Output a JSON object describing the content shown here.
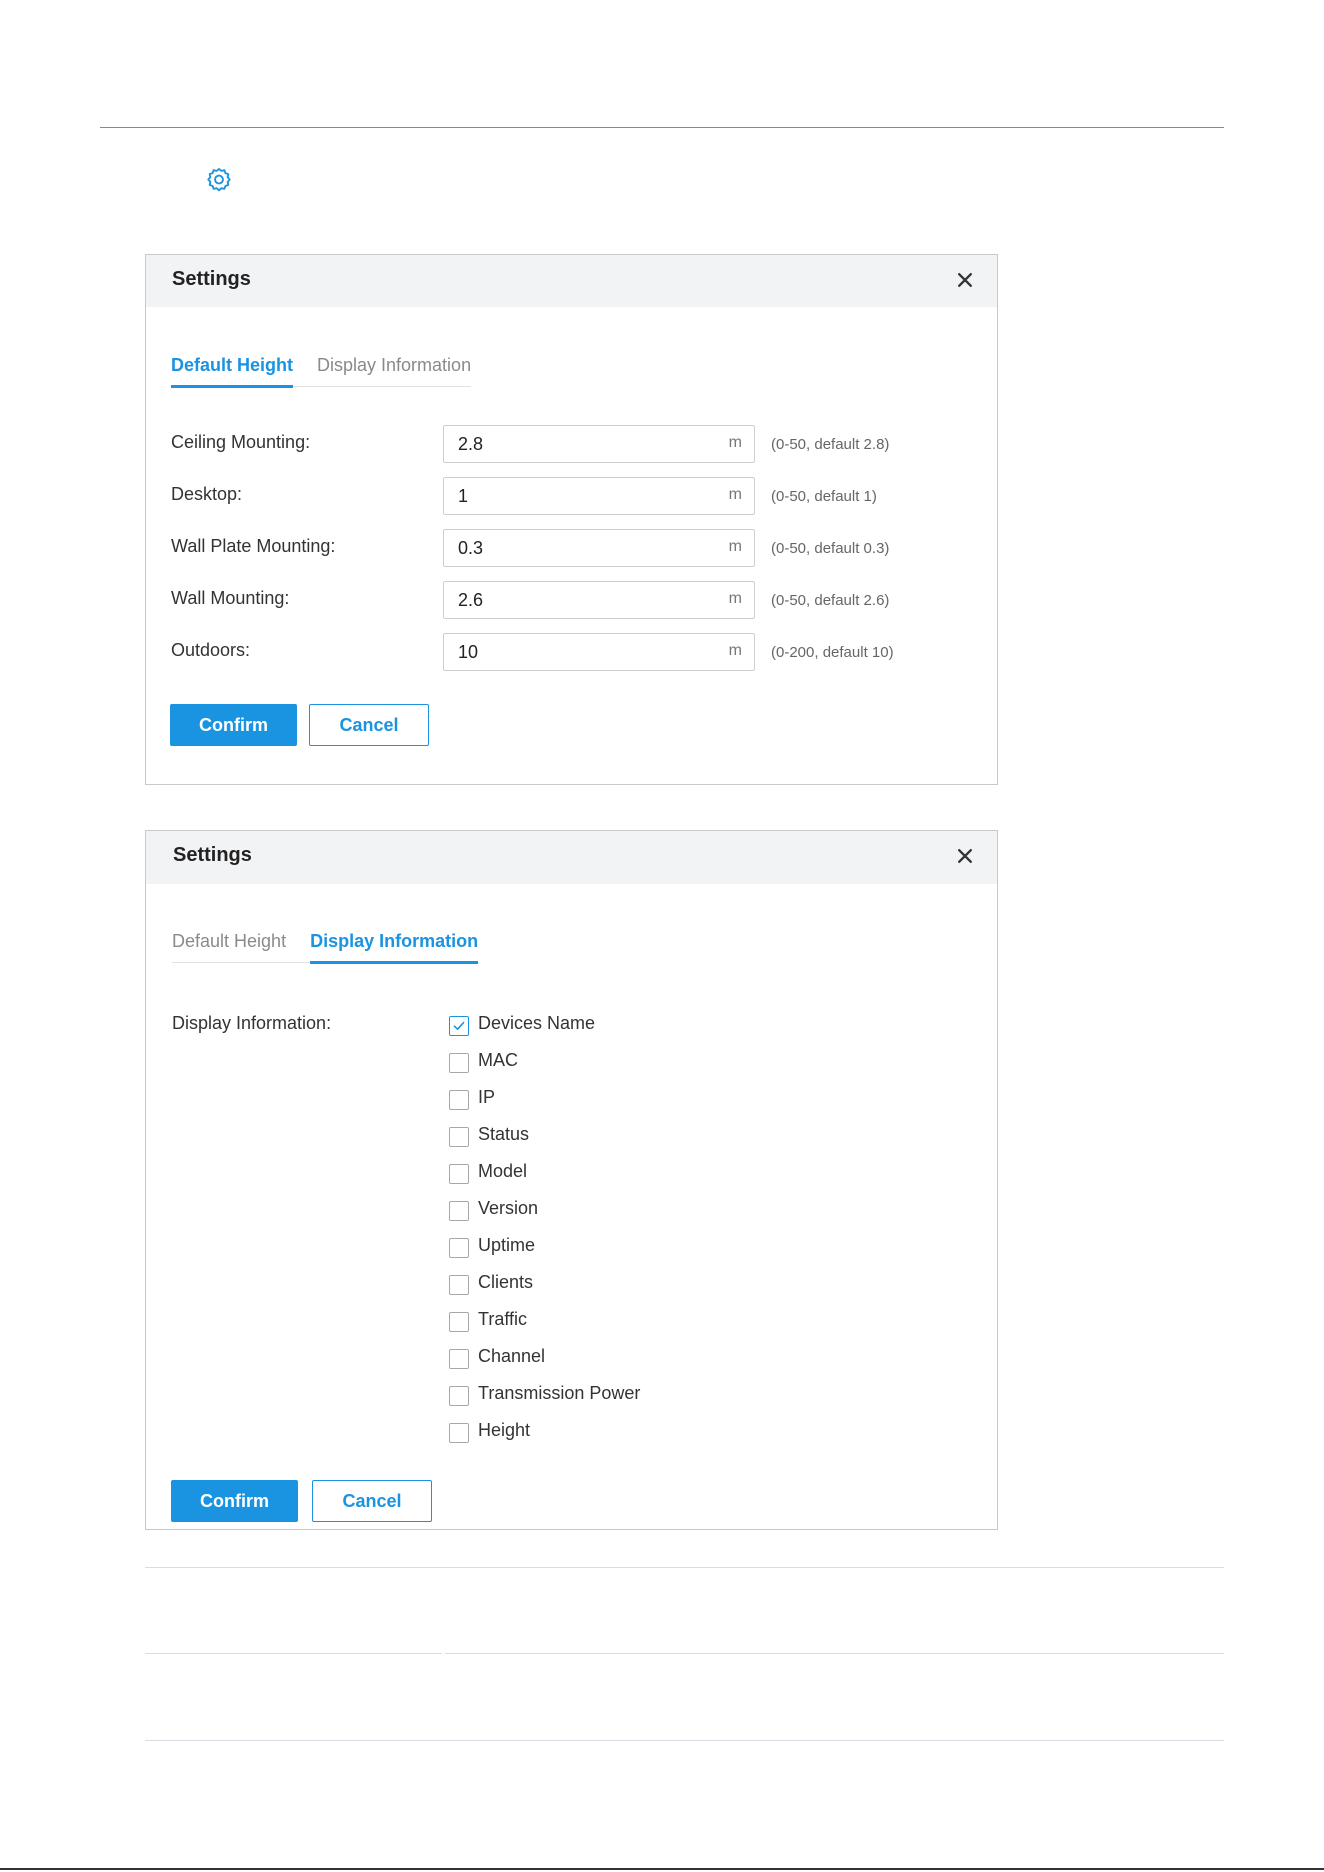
{
  "colors": {
    "accent": "#1a93e0",
    "header_bg": "#f2f3f5",
    "border": "#c9c9c9"
  },
  "page": {
    "settings_icon": "gear-icon"
  },
  "dialog1": {
    "title": "Settings",
    "close_icon": "close-icon",
    "tabs": [
      {
        "label": "Default Height",
        "active": true
      },
      {
        "label": "Display Information",
        "active": false
      }
    ],
    "fields": [
      {
        "label": "Ceiling Mounting:",
        "value": "2.8",
        "unit": "m",
        "hint": "(0-50, default 2.8)"
      },
      {
        "label": "Desktop:",
        "value": "1",
        "unit": "m",
        "hint": "(0-50, default 1)"
      },
      {
        "label": "Wall Plate Mounting:",
        "value": "0.3",
        "unit": "m",
        "hint": "(0-50, default 0.3)"
      },
      {
        "label": "Wall Mounting:",
        "value": "2.6",
        "unit": "m",
        "hint": "(0-50, default 2.6)"
      },
      {
        "label": "Outdoors:",
        "value": "10",
        "unit": "m",
        "hint": "(0-200, default 10)"
      }
    ],
    "confirm_label": "Confirm",
    "cancel_label": "Cancel"
  },
  "dialog2": {
    "title": "Settings",
    "close_icon": "close-icon",
    "tabs": [
      {
        "label": "Default Height",
        "active": false
      },
      {
        "label": "Display Information",
        "active": true
      }
    ],
    "display_label": "Display Information:",
    "options": [
      {
        "label": "Devices Name",
        "checked": true
      },
      {
        "label": "MAC",
        "checked": false
      },
      {
        "label": "IP",
        "checked": false
      },
      {
        "label": "Status",
        "checked": false
      },
      {
        "label": "Model",
        "checked": false
      },
      {
        "label": "Version",
        "checked": false
      },
      {
        "label": "Uptime",
        "checked": false
      },
      {
        "label": "Clients",
        "checked": false
      },
      {
        "label": "Traffic",
        "checked": false
      },
      {
        "label": "Channel",
        "checked": false
      },
      {
        "label": "Transmission Power",
        "checked": false
      },
      {
        "label": "Height",
        "checked": false
      }
    ],
    "confirm_label": "Confirm",
    "cancel_label": "Cancel"
  }
}
